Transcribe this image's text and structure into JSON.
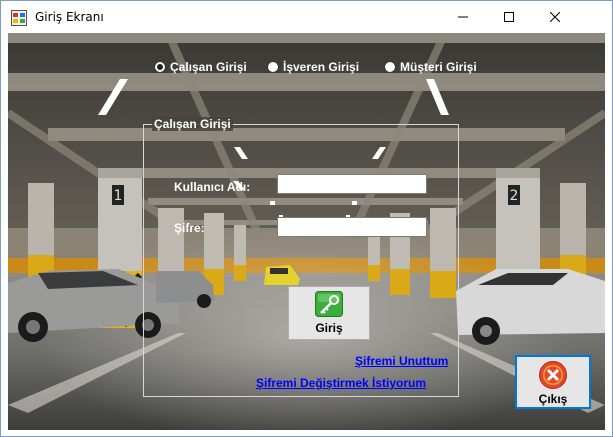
{
  "window": {
    "title": "Giriş Ekranı"
  },
  "login_type": {
    "options": [
      {
        "label": "Çalışan Girişi",
        "checked": true
      },
      {
        "label": "İşveren Girişi",
        "checked": false
      },
      {
        "label": "Müşteri Girişi",
        "checked": false
      }
    ]
  },
  "login_group": {
    "title": "Çalışan Girişi",
    "username_label": "Kullanıcı Adı:",
    "username_value": "",
    "password_label": "Şifre:",
    "password_value": ""
  },
  "buttons": {
    "login_label": "Giriş",
    "exit_label": "Çıkış"
  },
  "links": {
    "forgot_password": "Şifremi Unuttum",
    "change_password": "Şifremi Değiştirmek İstiyorum"
  },
  "colors": {
    "link": "#0000ff",
    "accent": "#0078d7"
  }
}
